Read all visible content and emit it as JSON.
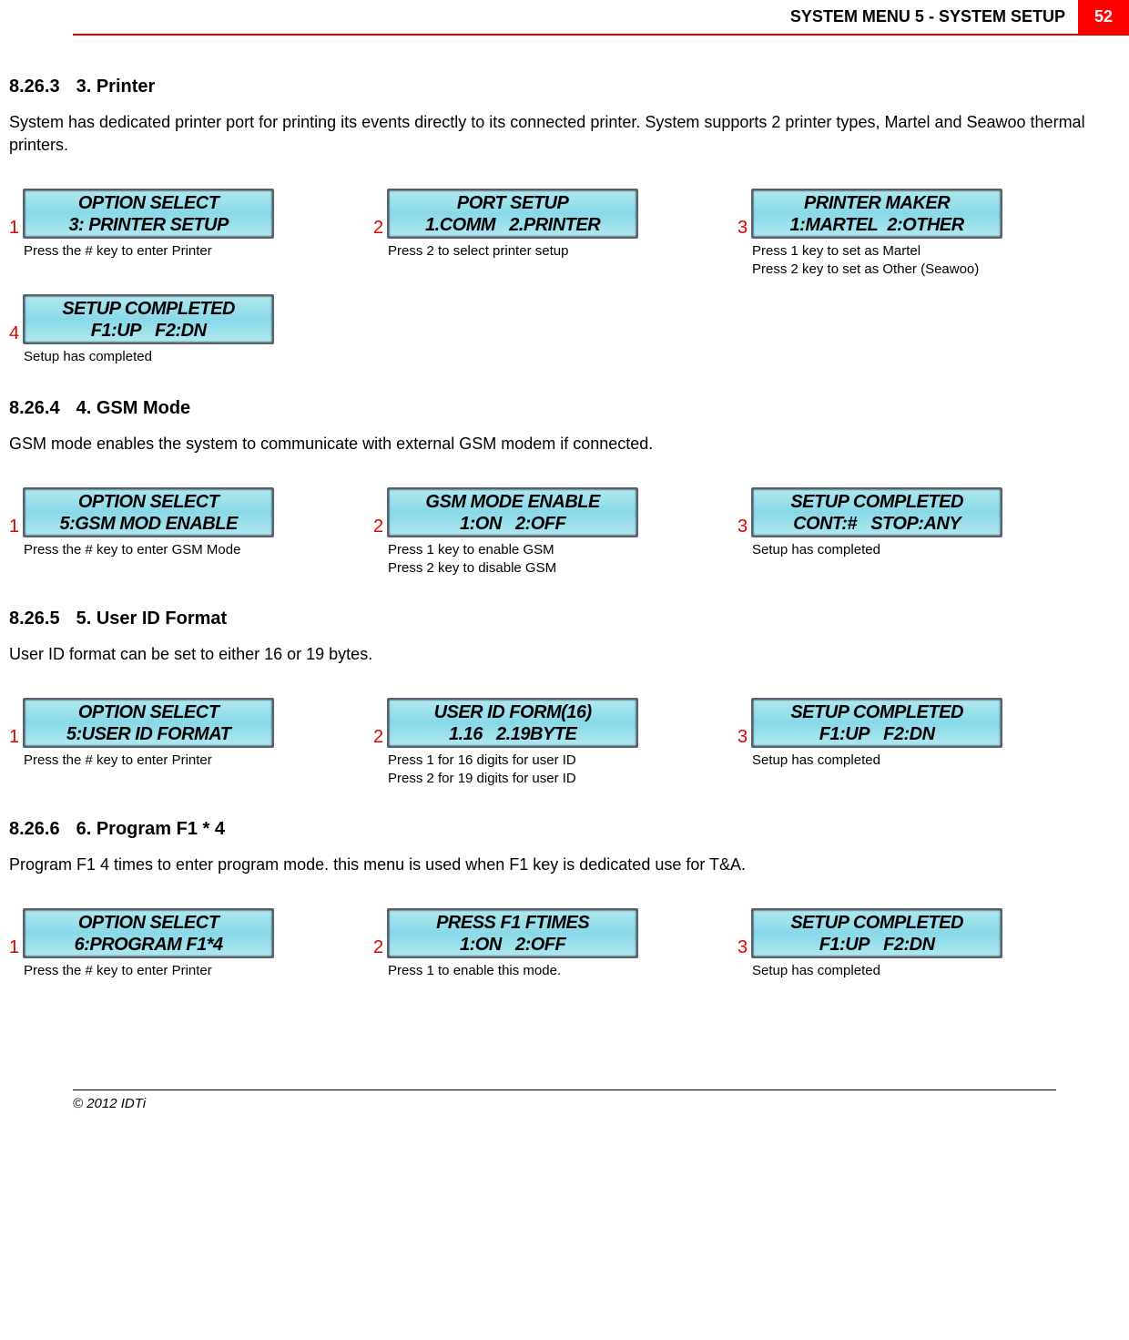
{
  "header": {
    "title": "SYSTEM MENU 5 - SYSTEM SETUP",
    "page": "52"
  },
  "sections": [
    {
      "num": "8.26.3",
      "title": "3. Printer",
      "desc": "System has dedicated printer port for printing its events directly to its connected printer. System supports 2 printer types, Martel and Seawoo thermal printers.",
      "steps": [
        {
          "n": "1",
          "l1": "OPTION SELECT",
          "l2": "3: PRINTER SETUP",
          "cap": [
            "Press the # key to enter Printer"
          ]
        },
        {
          "n": "2",
          "l1": "PORT SETUP",
          "l2": "1.COMM   2.PRINTER",
          "cap": [
            "Press 2 to select printer setup"
          ]
        },
        {
          "n": "3",
          "l1": "PRINTER MAKER",
          "l2": "1:MARTEL  2:OTHER",
          "cap": [
            "Press 1 key to set as Martel",
            "Press 2 key to set as Other (Seawoo)"
          ]
        },
        {
          "n": "4",
          "l1": "SETUP COMPLETED",
          "l2": "F1:UP   F2:DN",
          "cap": [
            "Setup has completed"
          ]
        }
      ]
    },
    {
      "num": "8.26.4",
      "title": "4. GSM Mode",
      "desc": "GSM mode enables the system to communicate with external GSM modem if connected.",
      "steps": [
        {
          "n": "1",
          "l1": "OPTION SELECT",
          "l2": "5:GSM MOD ENABLE",
          "cap": [
            "Press the # key to enter GSM Mode"
          ]
        },
        {
          "n": "2",
          "l1": "GSM MODE ENABLE",
          "l2": "1:ON   2:OFF",
          "cap": [
            "Press 1 key to enable GSM",
            "Press 2 key to disable GSM"
          ]
        },
        {
          "n": "3",
          "l1": "SETUP COMPLETED",
          "l2": "CONT:#   STOP:ANY",
          "cap": [
            "Setup has completed"
          ]
        }
      ]
    },
    {
      "num": "8.26.5",
      "title": "5. User ID Format",
      "desc": "User ID format can be set to either 16 or 19 bytes.",
      "steps": [
        {
          "n": "1",
          "l1": "OPTION SELECT",
          "l2": "5:USER ID FORMAT",
          "cap": [
            "Press the # key to enter Printer"
          ]
        },
        {
          "n": "2",
          "l1": "USER ID FORM(16)",
          "l2": "1.16   2.19BYTE",
          "cap": [
            "Press 1 for 16 digits for user ID",
            "Press 2 for 19 digits for user ID"
          ]
        },
        {
          "n": "3",
          "l1": "SETUP COMPLETED",
          "l2": "F1:UP   F2:DN",
          "cap": [
            "Setup has completed"
          ]
        }
      ]
    },
    {
      "num": "8.26.6",
      "title": "6. Program F1 * 4",
      "desc": "Program F1 4 times to enter program mode. this menu is used when F1 key is dedicated use for T&A.",
      "steps": [
        {
          "n": "1",
          "l1": "OPTION SELECT",
          "l2": "6:PROGRAM F1*4",
          "cap": [
            "Press the # key to enter Printer"
          ]
        },
        {
          "n": "2",
          "l1": "PRESS F1 FTIMES",
          "l2": "1:ON   2:OFF",
          "cap": [
            "Press 1 to enable this mode."
          ]
        },
        {
          "n": "3",
          "l1": "SETUP COMPLETED",
          "l2": "F1:UP   F2:DN",
          "cap": [
            "Setup has completed"
          ]
        }
      ]
    }
  ],
  "footer": "© 2012 IDTi"
}
